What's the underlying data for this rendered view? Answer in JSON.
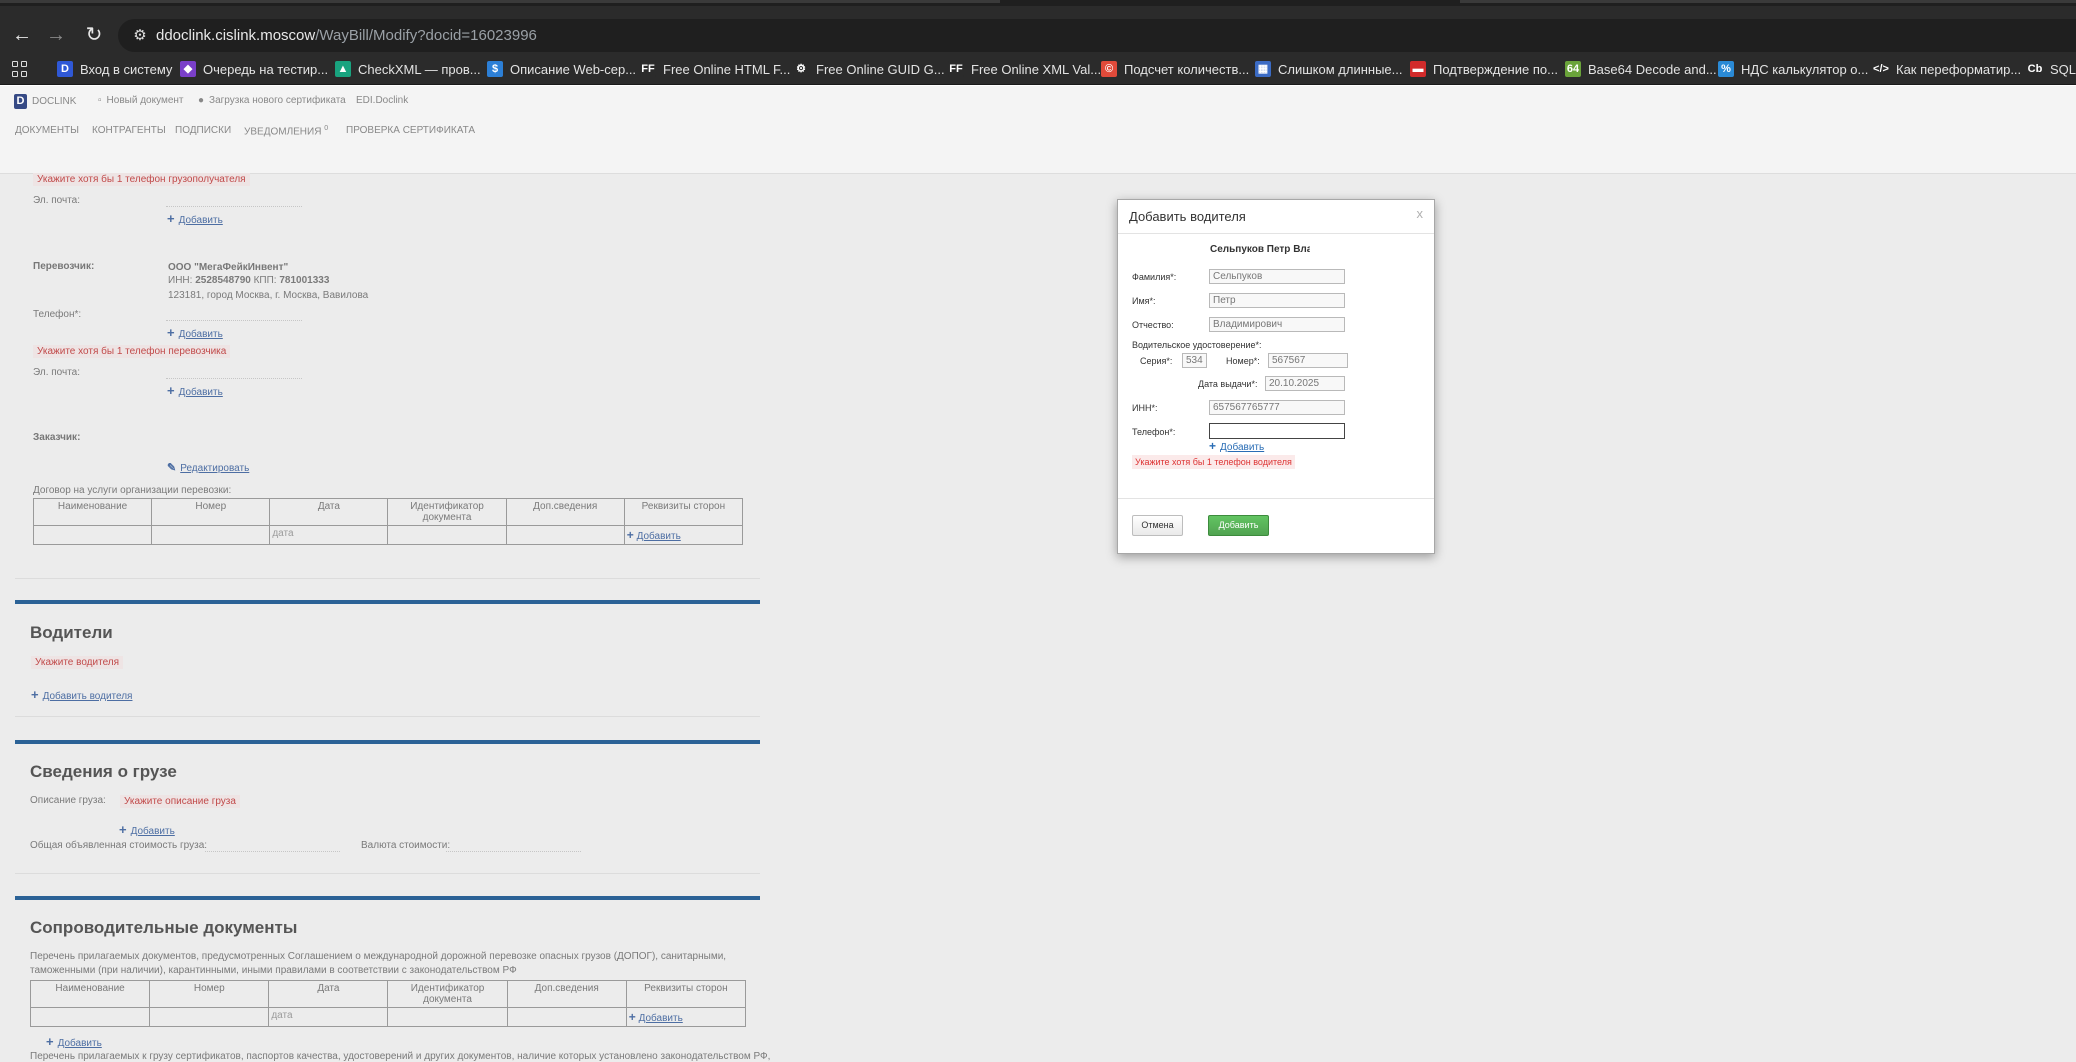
{
  "browser": {
    "url_host": "ddoclink.cislink.moscow",
    "url_path": "/WayBill/Modify?docid=16023996",
    "bookmarks": [
      {
        "label": "Вход в систему",
        "icon": "D",
        "color": "#2f58d6"
      },
      {
        "label": "Очередь на тестир...",
        "icon": "◆",
        "color": "#7a3fc9"
      },
      {
        "label": "CheckXML — пров...",
        "icon": "▲",
        "color": "#19a37f"
      },
      {
        "label": "Описание Web-сер...",
        "icon": "$",
        "color": "#2c7fd6"
      },
      {
        "label": "Free Online HTML F...",
        "icon": "FF",
        "color": "#2b2b2b"
      },
      {
        "label": "Free Online GUID G...",
        "icon": "⚙",
        "color": "#2b2b2b"
      },
      {
        "label": "Free Online XML Val...",
        "icon": "FF",
        "color": "#2b2b2b"
      },
      {
        "label": "Подсчет количеств...",
        "icon": "©",
        "color": "#e04a3a"
      },
      {
        "label": "Слишком длинные...",
        "icon": "▦",
        "color": "#3b6bc4"
      },
      {
        "label": "Подтверждение по...",
        "icon": "▬",
        "color": "#d12b2b"
      },
      {
        "label": "Base64 Decode and...",
        "icon": "64",
        "color": "#6aa33a"
      },
      {
        "label": "НДС калькулятор о...",
        "icon": "%",
        "color": "#2a8ad6"
      },
      {
        "label": "Как переформатир...",
        "icon": "</>",
        "color": "#2b2b2b"
      },
      {
        "label": "SQL F",
        "icon": "Cb",
        "color": "#2b2b2b"
      }
    ]
  },
  "app": {
    "brand": "DOCLINK",
    "top_links": [
      "Новый документ",
      "Загрузка нового сертификата",
      "EDI.Doclink"
    ],
    "menu": [
      "ДОКУМЕНТЫ",
      "КОНТРАГЕНТЫ",
      "ПОДПИСКИ",
      "УВЕДОМЛЕНИЯ",
      "ПРОВЕРКА СЕРТИФИКАТА"
    ],
    "notifications_count": "0"
  },
  "form": {
    "consignee_phone_error": "Укажите хотя бы 1 телефон грузополучателя",
    "email_label": "Эл. почта:",
    "add_label": "Добавить",
    "carrier_label": "Перевозчик:",
    "carrier_name": "ООО \"МегаФейкИнвент\"",
    "carrier_inn_label": "ИНН:",
    "carrier_inn": "2528548790",
    "carrier_kpp_label": "КПП:",
    "carrier_kpp": "781001333",
    "carrier_address": "123181, город Москва, г. Москва, Вавилова",
    "phone_label": "Телефон*:",
    "carrier_phone_error": "Укажите хотя бы 1 телефон перевозчика",
    "customer_label": "Заказчик:",
    "edit_label": "Редактировать",
    "contract_label": "Договор на услуги организации перевозки:",
    "table_headers": [
      "Наименование",
      "Номер",
      "Дата",
      "Идентификатор документа",
      "Доп.сведения",
      "Реквизиты сторон"
    ],
    "date_placeholder": "дата",
    "drivers_title": "Водители",
    "drivers_error": "Укажите водителя",
    "add_driver": "Добавить водителя",
    "cargo_title": "Сведения о грузе",
    "cargo_desc_label": "Описание груза:",
    "cargo_desc_error": "Укажите описание груза",
    "cargo_value_label": "Общая объявленная стоимость груза:",
    "currency_label": "Валюта стоимости:",
    "docs_title": "Сопроводительные документы",
    "docs_desc": "Перечень прилагаемых документов, предусмотренных Соглашением о международной дорожной перевозке опасных грузов (ДОПОГ), санитарными,",
    "docs_desc2": "таможенными (при наличии), карантинными, иными правилами в соответствии с законодательством РФ",
    "docs_desc3": "Перечень прилагаемых к грузу сертификатов, паспортов качества, удостоверений и других документов, наличие которых установлено законодательством РФ,"
  },
  "modal": {
    "title": "Добавить водителя",
    "close": "x",
    "driver_display": "Сельпуков Петр Владимирович",
    "surname_label": "Фамилия*:",
    "surname": "Сельпуков",
    "name_label": "Имя*:",
    "name": "Петр",
    "patronymic_label": "Отчество:",
    "patronymic": "Владимирович",
    "license_label": "Водительское удостоверение*:",
    "series_label": "Серия*:",
    "series": "534",
    "number_label": "Номер*:",
    "number": "567567",
    "issue_date_label": "Дата выдачи*:",
    "issue_date": "20.10.2025",
    "inn_label": "ИНН*:",
    "inn": "657567765777",
    "phone_label": "Телефон*:",
    "phone": "",
    "add_phone": "Добавить",
    "phone_error": "Укажите хотя бы 1 телефон водителя",
    "cancel": "Отмена",
    "submit": "Добавить"
  }
}
